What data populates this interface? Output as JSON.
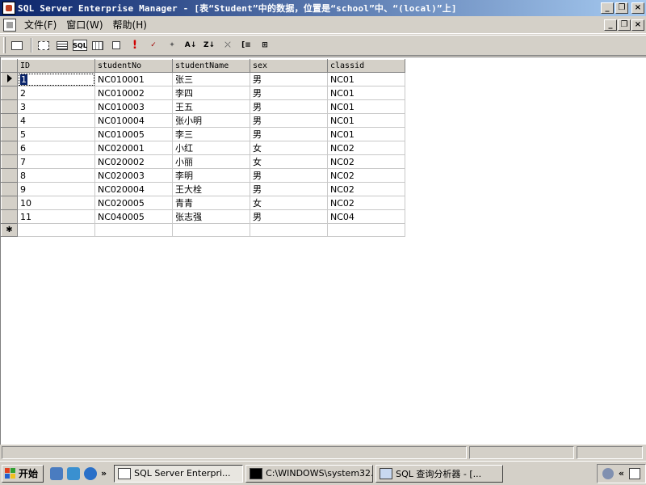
{
  "window": {
    "title": "SQL Server Enterprise Manager - [表“Student”中的数据，位置是“school”中、“(local)”上]",
    "minimize": "_",
    "restore": "❐",
    "close": "×"
  },
  "menu": {
    "items": [
      "文件(F)",
      "窗口(W)",
      "帮助(H)"
    ]
  },
  "toolbar": {
    "icons": [
      "properties-icon",
      "show-diagram-pane-icon",
      "show-grid-pane-icon",
      "show-sql-pane-icon",
      "show-results-pane-icon",
      "change-query-type-icon",
      "run-icon",
      "verify-sql-icon",
      "remove-filter-icon",
      "sort-ascending-icon",
      "sort-descending-icon",
      "remove-filter-icon-2",
      "group-by-icon",
      "add-table-icon"
    ],
    "sql_label": "SQL",
    "run_label": "!",
    "sort_asc_label": "A↓",
    "sort_desc_label": "Z↓"
  },
  "grid": {
    "columns": [
      "ID",
      "studentNo",
      "studentName",
      "sex",
      "classid"
    ],
    "rows": [
      [
        "1",
        "NC010001",
        "张三",
        "男",
        "NC01"
      ],
      [
        "2",
        "NC010002",
        "李四",
        "男",
        "NC01"
      ],
      [
        "3",
        "NC010003",
        "王五",
        "男",
        "NC01"
      ],
      [
        "4",
        "NC010004",
        "张小明",
        "男",
        "NC01"
      ],
      [
        "5",
        "NC010005",
        "李三",
        "男",
        "NC01"
      ],
      [
        "6",
        "NC020001",
        "小红",
        "女",
        "NC02"
      ],
      [
        "7",
        "NC020002",
        "小丽",
        "女",
        "NC02"
      ],
      [
        "8",
        "NC020003",
        "李明",
        "男",
        "NC02"
      ],
      [
        "9",
        "NC020004",
        "王大栓",
        "男",
        "NC02"
      ],
      [
        "10",
        "NC020005",
        "青青",
        "女",
        "NC02"
      ],
      [
        "11",
        "NC040005",
        "张志强",
        "男",
        "NC04"
      ]
    ],
    "new_row_marker": "✱",
    "current_row": 0
  },
  "taskbar": {
    "start_label": "开始",
    "chevron": "»",
    "tasks": [
      {
        "label": "SQL Server Enterpri...",
        "active": true
      },
      {
        "label": "C:\\WINDOWS\\system32...",
        "active": false
      },
      {
        "label": "SQL 查询分析器 - [...",
        "active": false
      }
    ],
    "tray_chevron": "«"
  },
  "colors": {
    "title_start": "#0a246a",
    "title_end": "#a6caf0",
    "selection": "#0a246a",
    "face": "#d4d0c8"
  }
}
